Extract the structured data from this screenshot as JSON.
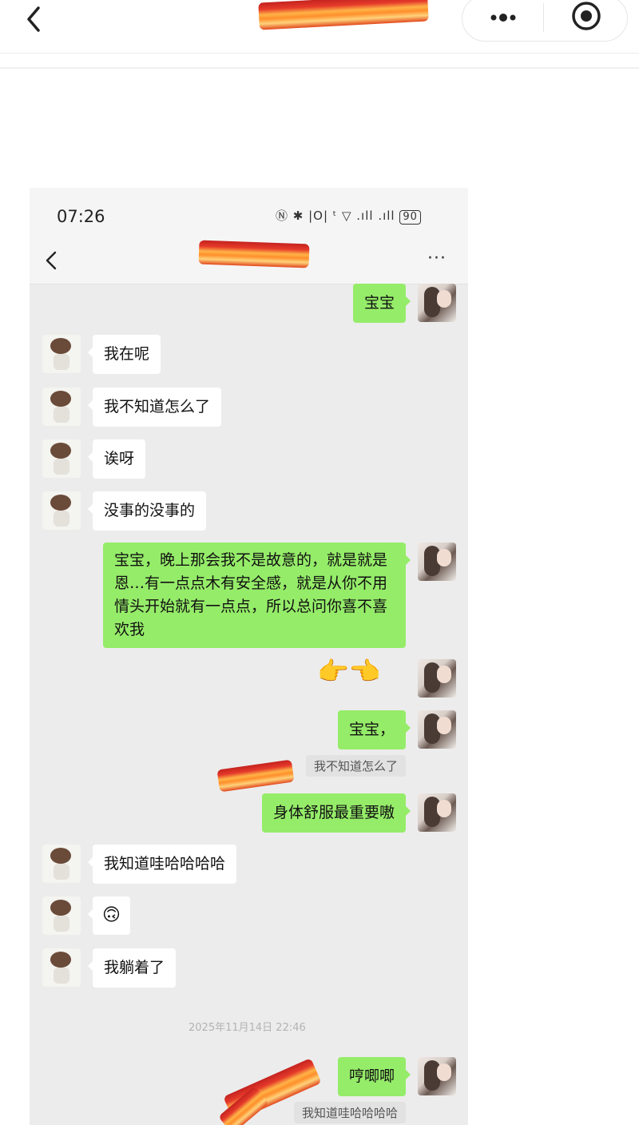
{
  "outer_header": {
    "back_icon": "chevron-left-icon",
    "more_icon": "more-dots-icon",
    "close_icon": "target-circle-icon"
  },
  "status_bar": {
    "time": "07:26",
    "icons": "Ⓝ ✱ |O| ᵗ ▽ .ıll .ıll",
    "battery": "90"
  },
  "chat_header": {
    "more": "···"
  },
  "messages": [
    {
      "side": "me",
      "text": "宝宝"
    },
    {
      "side": "other",
      "text": "我在呢"
    },
    {
      "side": "other",
      "text": "我不知道怎么了"
    },
    {
      "side": "other",
      "text": "诶呀"
    },
    {
      "side": "other",
      "text": "没事的没事的"
    },
    {
      "side": "me",
      "text": "宝宝，晚上那会我不是故意的，就是就是恩…有一点点木有安全感，就是从你不用情头开始就有一点点，所以总问你喜不喜欢我"
    },
    {
      "side": "me",
      "text": "👉👈"
    },
    {
      "side": "me",
      "text": "宝宝，"
    },
    {
      "side": "me",
      "text": "身体舒服最重要嗷",
      "quote": "我不知道怎么了"
    },
    {
      "side": "other",
      "text": "我知道哇哈哈哈哈"
    },
    {
      "side": "other",
      "text": "🙃"
    },
    {
      "side": "other",
      "text": "我躺着了"
    },
    {
      "side": "me",
      "text": "哼唧唧",
      "quote": "我知道哇哈哈哈哈"
    }
  ],
  "timestamp": "2025年11月14日 22:46",
  "colors": {
    "bubble_me": "#95ec69",
    "bubble_other": "#ffffff",
    "chat_bg": "#ececec"
  }
}
